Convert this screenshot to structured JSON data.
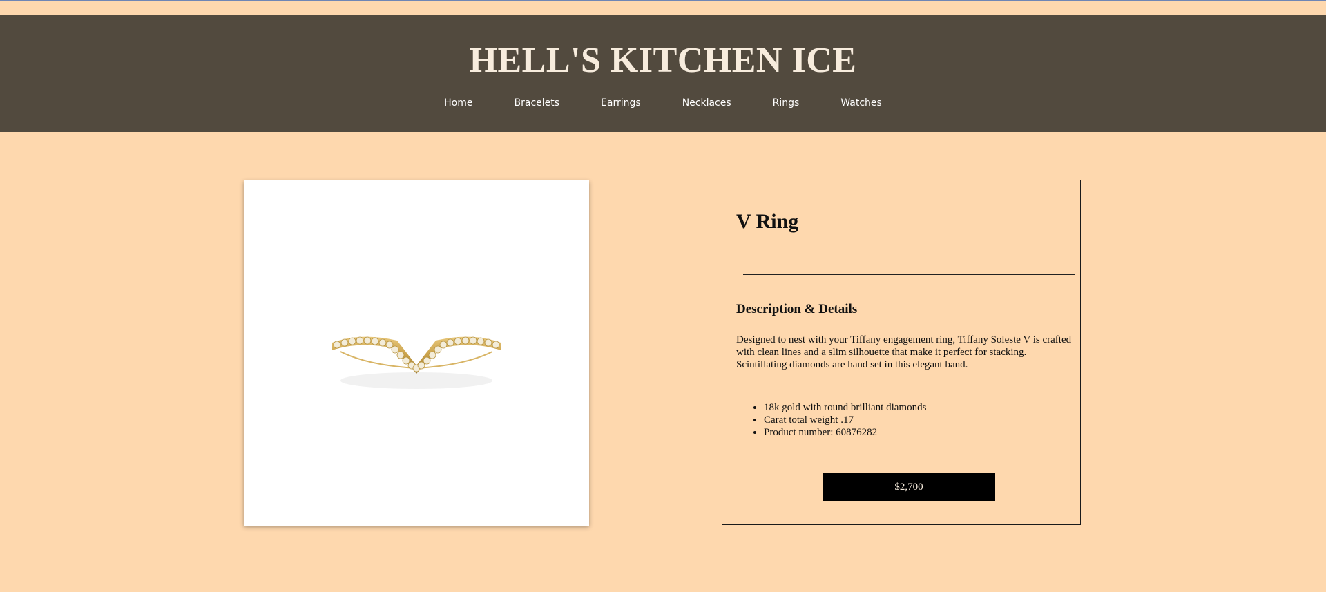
{
  "site": {
    "title": "HELL'S KITCHEN ICE"
  },
  "nav": {
    "items": [
      {
        "label": "Home"
      },
      {
        "label": "Bracelets"
      },
      {
        "label": "Earrings"
      },
      {
        "label": "Necklaces"
      },
      {
        "label": "Rings"
      },
      {
        "label": "Watches"
      }
    ]
  },
  "product": {
    "name": "V Ring",
    "section_heading": "Description & Details",
    "description": "Designed to nest with your Tiffany engagement ring, Tiffany Soleste V is crafted with clean lines and a slim silhouette that make it perfect for stacking. Scintillating diamonds are hand set in this elegant band.",
    "specs": [
      "18k gold with round brilliant diamonds",
      "Carat total weight .17",
      "Product number: 60876282"
    ],
    "price": "$2,700",
    "image_icon": "ring-image"
  },
  "colors": {
    "background": "#fed8ae",
    "header": "#524a3e",
    "title_text": "#f7ecdd",
    "button": "#000000",
    "gold": "#c9a14a"
  }
}
